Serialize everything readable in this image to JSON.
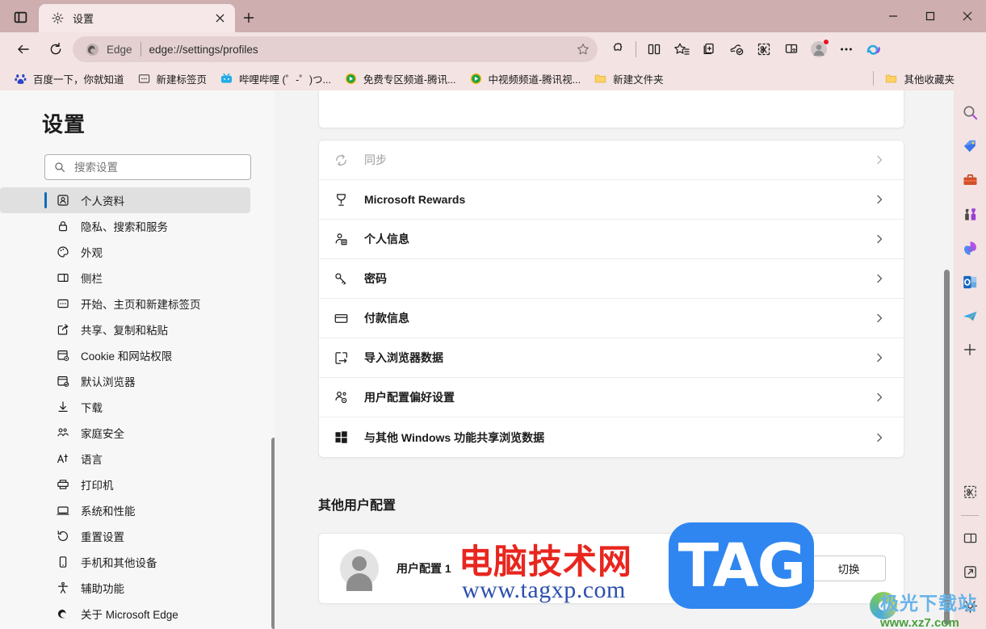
{
  "window": {
    "title": "设置",
    "controls": {
      "minimize": "—",
      "maximize": "□",
      "close": "✕"
    }
  },
  "tab": {
    "title": "设置",
    "close_label": "✕",
    "newtab_label": "+"
  },
  "address": {
    "brand": "Edge",
    "url": "edge://settings/profiles",
    "star_title": "添加到收藏夹"
  },
  "bookmarks": {
    "items": [
      {
        "label": "百度一下，你就知道",
        "icon": "baidu-icon"
      },
      {
        "label": "新建标签页",
        "icon": "newtab-icon"
      },
      {
        "label": "哔哩哔哩 (゜-゜)つ...",
        "icon": "bilibili-icon"
      },
      {
        "label": "免费专区频道-腾讯...",
        "icon": "tencent-video-icon"
      },
      {
        "label": "中视频频道-腾讯视...",
        "icon": "tencent-video-icon"
      },
      {
        "label": "新建文件夹",
        "icon": "folder-icon"
      }
    ],
    "other_favorites": "其他收藏夹"
  },
  "settings": {
    "title": "设置",
    "search_placeholder": "搜索设置",
    "nav_items": [
      {
        "label": "个人资料",
        "icon": "profile-icon",
        "active": true
      },
      {
        "label": "隐私、搜索和服务",
        "icon": "lock-icon",
        "active": false
      },
      {
        "label": "外观",
        "icon": "palette-icon",
        "active": false
      },
      {
        "label": "侧栏",
        "icon": "sidebar-icon",
        "active": false
      },
      {
        "label": "开始、主页和新建标签页",
        "icon": "home-icon",
        "active": false
      },
      {
        "label": "共享、复制和粘贴",
        "icon": "share-icon",
        "active": false
      },
      {
        "label": "Cookie 和网站权限",
        "icon": "cookie-icon",
        "active": false
      },
      {
        "label": "默认浏览器",
        "icon": "default-browser-icon",
        "active": false
      },
      {
        "label": "下载",
        "icon": "download-icon",
        "active": false
      },
      {
        "label": "家庭安全",
        "icon": "family-icon",
        "active": false
      },
      {
        "label": "语言",
        "icon": "language-icon",
        "active": false
      },
      {
        "label": "打印机",
        "icon": "printer-icon",
        "active": false
      },
      {
        "label": "系统和性能",
        "icon": "system-icon",
        "active": false
      },
      {
        "label": "重置设置",
        "icon": "reset-icon",
        "active": false
      },
      {
        "label": "手机和其他设备",
        "icon": "phone-icon",
        "active": false
      },
      {
        "label": "辅助功能",
        "icon": "accessibility-icon",
        "active": false
      },
      {
        "label": "关于 Microsoft Edge",
        "icon": "edge-icon",
        "active": false
      }
    ]
  },
  "main": {
    "rows": [
      {
        "label": "同步",
        "icon": "sync-icon",
        "disabled": true
      },
      {
        "label": "Microsoft Rewards",
        "icon": "rewards-icon",
        "disabled": false
      },
      {
        "label": "个人信息",
        "icon": "personal-info-icon",
        "disabled": false
      },
      {
        "label": "密码",
        "icon": "key-icon",
        "disabled": false
      },
      {
        "label": "付款信息",
        "icon": "card-icon",
        "disabled": false
      },
      {
        "label": "导入浏览器数据",
        "icon": "import-icon",
        "disabled": false
      },
      {
        "label": "用户配置偏好设置",
        "icon": "profile-prefs-icon",
        "disabled": false
      },
      {
        "label": "与其他 Windows 功能共享浏览数据",
        "icon": "windows-icon",
        "disabled": false
      }
    ],
    "other_profiles_title": "其他用户配置",
    "profile": {
      "name": "用户配置 1",
      "switch_label": "切换"
    }
  },
  "sidebar_rail": {
    "items": [
      {
        "icon": "search-icon"
      },
      {
        "icon": "shopping-tag-icon"
      },
      {
        "icon": "tools-briefcase-icon"
      },
      {
        "icon": "games-icon"
      },
      {
        "icon": "office-icon"
      },
      {
        "icon": "outlook-icon"
      },
      {
        "icon": "telegram-icon"
      },
      {
        "icon": "add-icon"
      }
    ],
    "bottom_items": [
      {
        "icon": "screenshot-icon"
      },
      {
        "icon": "split-pane-icon"
      },
      {
        "icon": "open-external-icon"
      },
      {
        "icon": "settings-gear-icon"
      }
    ]
  },
  "watermarks": {
    "center_cn": "电脑技术网",
    "center_url": "www.tagxp.com",
    "tag_logo": "TAG",
    "bottom_right_cn": "极光下载站",
    "bottom_right_url": "www.xz7.com"
  }
}
